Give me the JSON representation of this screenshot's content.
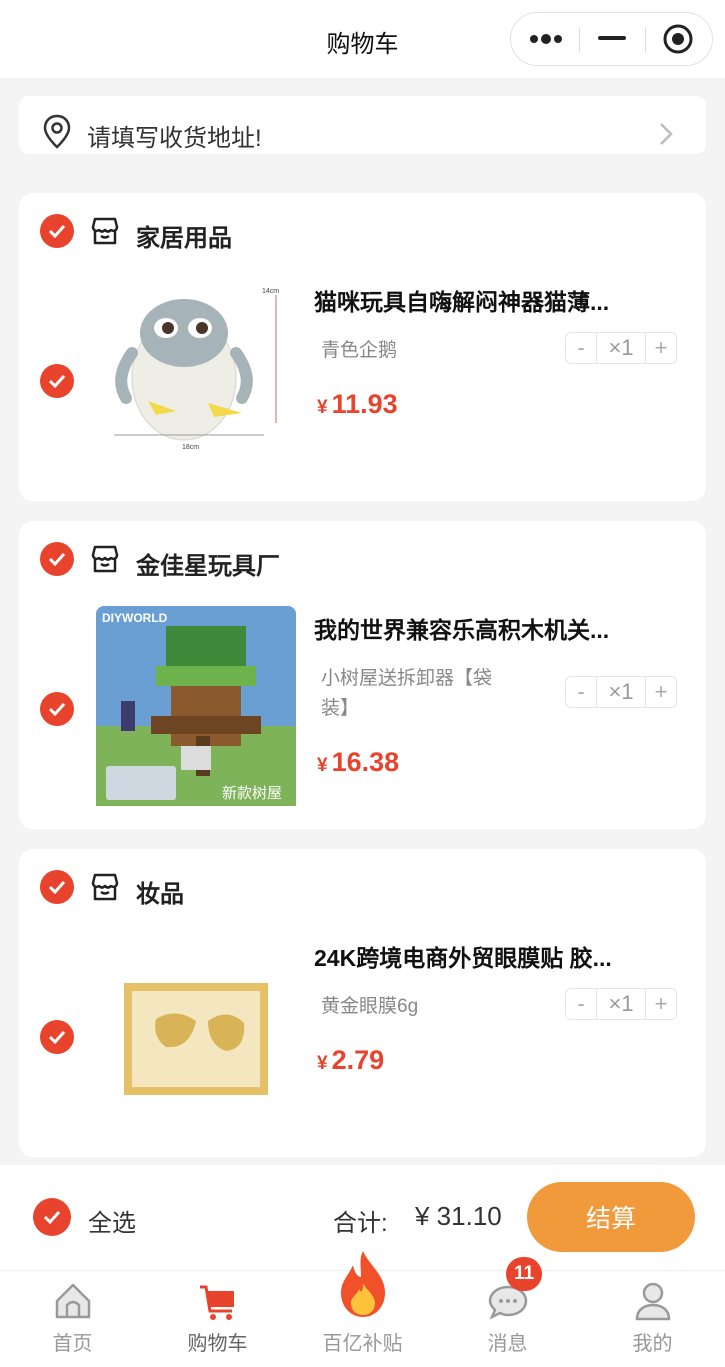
{
  "header": {
    "title": "购物车",
    "more_icon": "more-dots-icon",
    "minimize_icon": "minimize-icon",
    "close_icon": "target-circle-icon"
  },
  "address": {
    "placeholder_text": "请填写收货地址!",
    "icon": "location-pin-icon",
    "chevron": "chevron-right-icon"
  },
  "stores": [
    {
      "name": "家居用品",
      "checked": true,
      "item": {
        "title": "猫咪玩具自嗨解闷神器猫薄...",
        "spec": "青色企鹅",
        "price_currency": "¥",
        "price": "11.93",
        "qty_minus": "-",
        "qty": "×1",
        "qty_plus": "+",
        "image_labels": {
          "height": "14cm",
          "width": "18cm"
        },
        "checked": true
      }
    },
    {
      "name": "金佳星玩具厂",
      "checked": true,
      "item": {
        "title": "我的世界兼容乐高积木机关...",
        "spec": "小树屋送拆卸器【袋装】",
        "price_currency": "¥",
        "price": "16.38",
        "qty_minus": "-",
        "qty": "×1",
        "qty_plus": "+",
        "image_labels": {
          "brand": "DIYWORLD",
          "caption": "新款树屋"
        },
        "checked": true
      }
    },
    {
      "name": "妆品",
      "checked": true,
      "item": {
        "title": "24K跨境电商外贸眼膜贴 胶...",
        "spec": "黄金眼膜6g",
        "price_currency": "¥",
        "price": "2.79",
        "qty_minus": "-",
        "qty": "×1",
        "qty_plus": "+",
        "checked": true
      }
    }
  ],
  "checkout": {
    "select_all": "全选",
    "total_label": "合计:",
    "total_value": "¥ 31.10",
    "button": "结算"
  },
  "tabbar": {
    "tabs": [
      {
        "label": "首页",
        "icon": "home-icon",
        "active": false
      },
      {
        "label": "购物车",
        "icon": "cart-icon",
        "active": true
      },
      {
        "label": "百亿补贴",
        "icon": "fire-icon",
        "active": false
      },
      {
        "label": "消息",
        "icon": "chat-bubble-icon",
        "active": false,
        "badge": "11"
      },
      {
        "label": "我的",
        "icon": "user-icon",
        "active": false
      }
    ]
  },
  "colors": {
    "accent": "#e8432d",
    "checkout": "#f19a3c",
    "background": "#f4f4f4"
  }
}
